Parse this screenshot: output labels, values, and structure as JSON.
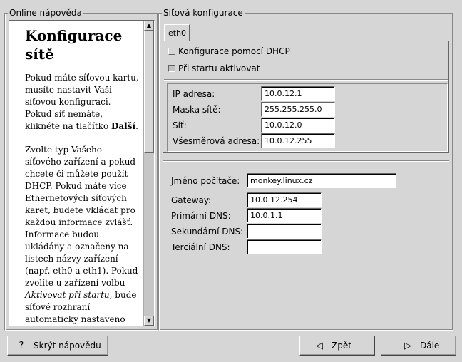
{
  "help_panel": {
    "group_title": "Online nápověda",
    "heading": "Konfigurace sítě",
    "paragraphs": [
      {
        "text_before": "Pokud máte síťovou kartu, musíte nastavit Vaši síťovou konfiguraci. Pokud síť nemáte, klikněte na tlačítko ",
        "emphasis": "Další",
        "text_after": "."
      },
      {
        "text_before": "Zvolte typ Vašeho síťového zařízení a pokud chcete či můžete použít DHCP. Pokud máte více Ethernetových síťových karet, budete vkládat pro každou informace zvlášť. Informace budou ukládány a označeny na listech názvy zařízení (např. eth0 a eth1). Pokud zvolíte u zařízení volbu ",
        "emphasis": "Aktivovat při startu",
        "text_after": ", bude síťové rozhraní automaticky nastaveno"
      }
    ],
    "scroll_up_arrow": "▲",
    "scroll_down_arrow": "▼"
  },
  "network": {
    "group_title": "Síťová konfigurace",
    "tab_label": "eth0",
    "dhcp_label": "Konfigurace pomocí DHCP",
    "dhcp_checked": false,
    "boot_label": "Při startu aktivovat",
    "boot_checked": true,
    "fields": [
      {
        "label": "IP adresa:",
        "value": "10.0.12.1"
      },
      {
        "label": "Maska sítě:",
        "value": "255.255.255.0"
      },
      {
        "label": "Síť:",
        "value": "10.0.12.0"
      },
      {
        "label": "Všesměrová adresa:",
        "value": "10.0.12.255"
      }
    ]
  },
  "host": {
    "hostname_label": "Jméno počítače:",
    "hostname_value": "monkey.linux.cz",
    "gateway_label": "Gateway:",
    "gateway_value": "10.0.12.254",
    "dns1_label": "Primární DNS:",
    "dns1_value": "10.0.1.1",
    "dns2_label": "Sekundární DNS:",
    "dns2_value": "",
    "dns3_label": "Terciální DNS:",
    "dns3_value": ""
  },
  "buttons": {
    "hide_help": "Skrýt nápovědu",
    "hide_help_icon": "?",
    "back": "Zpět",
    "back_icon": "◁",
    "next": "Dále",
    "next_icon": "▷"
  },
  "colors": {
    "window_bg": "#d6d6d6",
    "field_bg": "#ffffff"
  }
}
